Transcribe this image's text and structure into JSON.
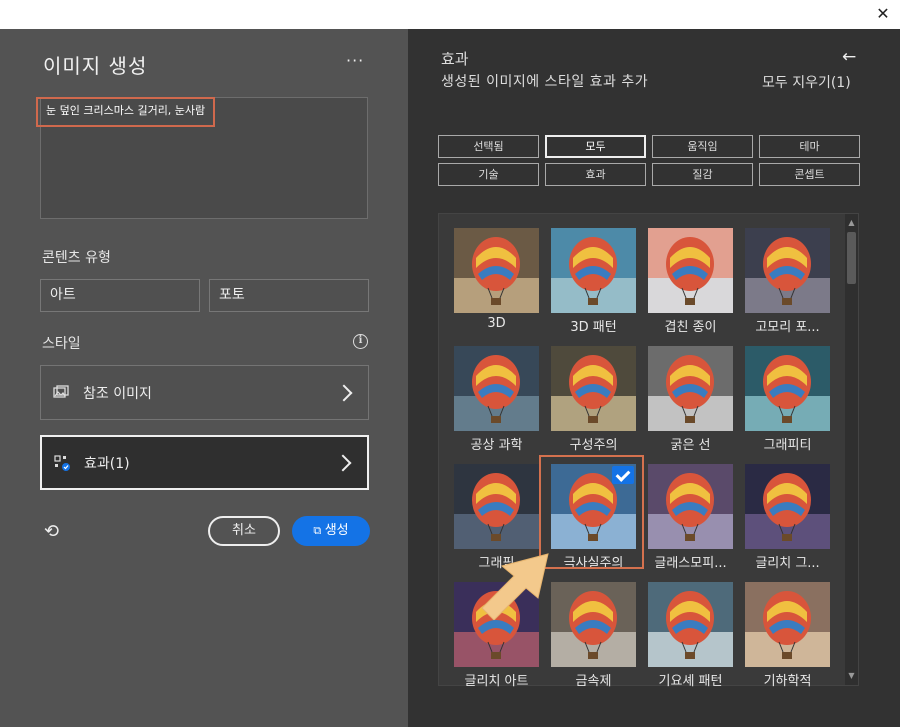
{
  "window": {
    "close_glyph": "✕"
  },
  "left_panel": {
    "title": "이미지 생성",
    "more_glyph": "···",
    "prompt_text": "눈 덮인 크리스마스 길거리, 눈사람",
    "content_type_label": "콘텐츠 유형",
    "content_types": [
      "아트",
      "포토"
    ],
    "style_label": "스타일",
    "info_glyph": "i",
    "reference_image_label": "참조 이미지",
    "effects_label": "효과(1)",
    "undo_glyph": "⟲",
    "cancel_label": "취소",
    "generate_label": "생성"
  },
  "right_panel": {
    "title": "효과",
    "subtitle": "생성된 이미지에 스타일 효과 추가",
    "back_glyph": "🡐",
    "clear_all_label": "모두 지우기(1)",
    "filters": [
      "선택됨",
      "모두",
      "움직임",
      "테마",
      "기술",
      "효과",
      "질감",
      "콘셉트"
    ],
    "active_filter": "모두",
    "effects": [
      {
        "label": "3D",
        "bg": "#6b5a45",
        "sky": "#c9b08a"
      },
      {
        "label": "3D 패턴",
        "bg": "#4d8aa8",
        "sky": "#a8c8d0"
      },
      {
        "label": "겹친 종이",
        "bg": "#e2a090",
        "sky": "#d7e6ec"
      },
      {
        "label": "고모리 포...",
        "bg": "#3c3f4e",
        "sky": "#8c8a98"
      },
      {
        "label": "공상 과학",
        "bg": "#374858",
        "sky": "#6e8a9a"
      },
      {
        "label": "구성주의",
        "bg": "#4f4a3c",
        "sky": "#c8b890"
      },
      {
        "label": "굵은 선",
        "bg": "#6c6c6c",
        "sky": "#d8d8d8"
      },
      {
        "label": "그래피티",
        "bg": "#2c5b68",
        "sky": "#8ac0c8"
      },
      {
        "label": "그래픽",
        "bg": "#2e3540",
        "sky": "#5a6a80"
      },
      {
        "label": "극사실주의",
        "bg": "#3d6a95",
        "sky": "#9fc3e2"
      },
      {
        "label": "글래스모피...",
        "bg": "#5a4a6a",
        "sky": "#a8a0c0"
      },
      {
        "label": "글리치 그...",
        "bg": "#2a2a44",
        "sky": "#6a5a8a"
      },
      {
        "label": "글리치 아트",
        "bg": "#3a2f5a",
        "sky": "#b05c6a"
      },
      {
        "label": "금속제",
        "bg": "#6a6258",
        "sky": "#c7c2b8"
      },
      {
        "label": "기요셰 패턴",
        "bg": "#4e6a7a",
        "sky": "#d0dce0"
      },
      {
        "label": "기하학적",
        "bg": "#8a7060",
        "sky": "#e0c8a8"
      }
    ],
    "selected_effect": "극사실주의"
  }
}
